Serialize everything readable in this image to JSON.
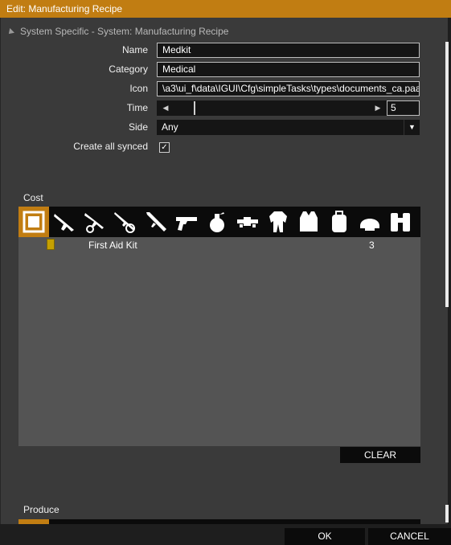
{
  "window": {
    "title": "Edit: Manufacturing Recipe"
  },
  "section": {
    "title": "System Specific - System: Manufacturing Recipe"
  },
  "fields": {
    "name_label": "Name",
    "name_value": "Medkit",
    "category_label": "Category",
    "category_value": "Medical",
    "icon_label": "Icon",
    "icon_value": "\\a3\\ui_f\\data\\IGUI\\Cfg\\simpleTasks\\types\\documents_ca.paa",
    "time_label": "Time",
    "time_value": "5",
    "side_label": "Side",
    "side_value": "Any",
    "sync_label": "Create all synced",
    "sync_checked": true
  },
  "cost": {
    "title": "Cost",
    "categories": [
      "all-items-icon",
      "assault-rifle-icon",
      "grenade-launcher-rifle-icon",
      "sniper-rifle-icon",
      "launcher-icon",
      "pistol-icon",
      "grenade-icon",
      "optic-icon",
      "uniform-icon",
      "vest-icon",
      "backpack-icon",
      "helmet-icon",
      "binoculars-icon"
    ],
    "items": [
      {
        "name": "First Aid Kit",
        "qty": "3"
      }
    ],
    "clear_label": "CLEAR"
  },
  "produce": {
    "title": "Produce"
  },
  "footer": {
    "ok_label": "OK",
    "cancel_label": "CANCEL"
  },
  "colors": {
    "accent": "#c17d12",
    "list_bg": "#545454",
    "panel_bg": "#3a3a3a"
  }
}
